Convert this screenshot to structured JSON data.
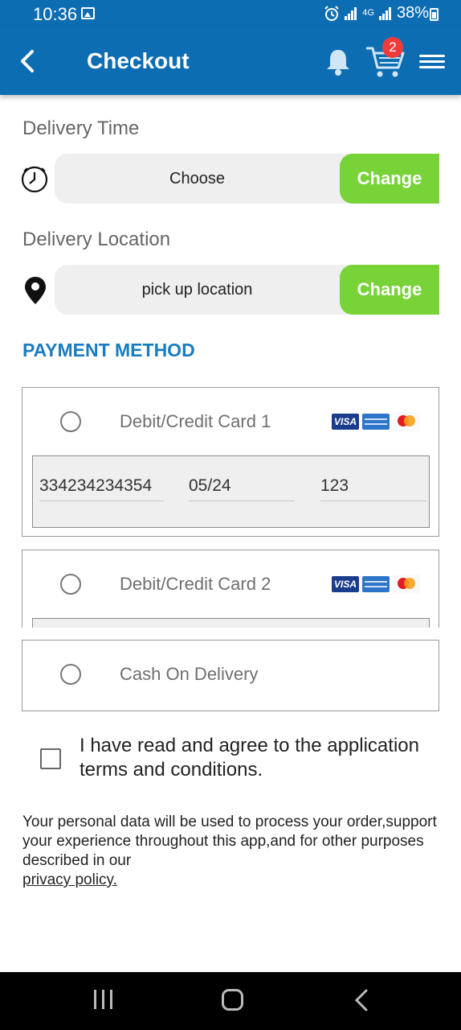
{
  "status_bar": {
    "time": "10:36",
    "network": "4G",
    "battery": "38%"
  },
  "header": {
    "title": "Checkout",
    "cart_count": "2",
    "icons": [
      "back-arrow-icon",
      "bell-icon",
      "cart-icon",
      "hamburger-menu-icon"
    ]
  },
  "delivery_time": {
    "label": "Delivery Time",
    "value": "Choose",
    "button": "Change",
    "icon": "clock-icon"
  },
  "delivery_location": {
    "label": "Delivery Location",
    "value": "pick up location",
    "button": "Change",
    "icon": "location-pin-icon"
  },
  "payment": {
    "heading": "PAYMENT METHOD",
    "options": [
      {
        "label": "Debit/Credit Card 1",
        "card_number": "334234234354",
        "expiry": "05/24",
        "cvv": "123"
      },
      {
        "label": "Debit/Credit Card 2"
      },
      {
        "label": "Cash On Delivery"
      }
    ],
    "card_brands": [
      "VISA",
      "AMERICAN EXPRESS",
      "mastercard"
    ]
  },
  "terms": {
    "text": "I have read and agree to the application terms and conditions."
  },
  "privacy": {
    "text": "Your personal data will be used to process your order,support your experience throughout this app,and for other purposes described in our",
    "link": "privacy policy."
  },
  "colors": {
    "primary": "#0d6db3",
    "accent_green": "#78d339",
    "heading_blue": "#1a7cc0",
    "badge_red": "#ef3b3b"
  }
}
